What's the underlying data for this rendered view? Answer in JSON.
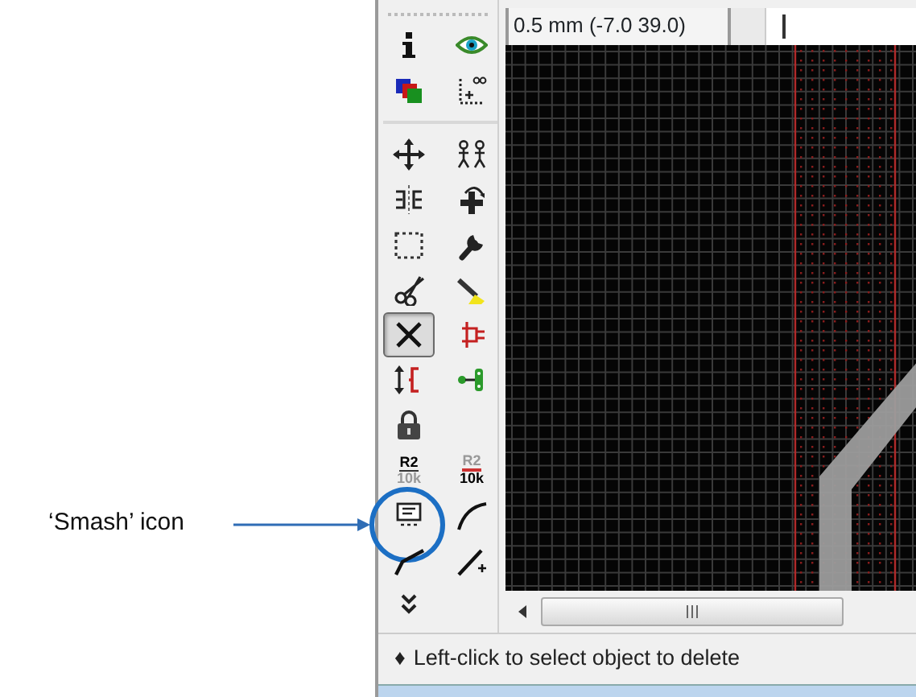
{
  "annotation": {
    "label": "‘Smash’ icon"
  },
  "toolbar": [
    {
      "kind": "info",
      "selected": false
    },
    {
      "kind": "eye",
      "selected": false
    },
    {
      "kind": "layers",
      "selected": false
    },
    {
      "kind": "mark",
      "selected": false
    },
    {
      "kind": "separator"
    },
    {
      "kind": "move",
      "selected": false
    },
    {
      "kind": "copy",
      "selected": false
    },
    {
      "kind": "mirror",
      "selected": false
    },
    {
      "kind": "rotate",
      "selected": false
    },
    {
      "kind": "group",
      "selected": false
    },
    {
      "kind": "wrench",
      "selected": false
    },
    {
      "kind": "scissors",
      "selected": false
    },
    {
      "kind": "pen",
      "selected": false
    },
    {
      "kind": "delete",
      "selected": true
    },
    {
      "kind": "ripup",
      "selected": false
    },
    {
      "kind": "swap",
      "selected": false
    },
    {
      "kind": "gateswap",
      "selected": false
    },
    {
      "kind": "lock",
      "selected": false
    },
    {
      "kind": "blank"
    },
    {
      "kind": "name",
      "selected": false,
      "lines": [
        "R2",
        "10k"
      ]
    },
    {
      "kind": "value",
      "selected": false,
      "lines": [
        "R2",
        "10k"
      ]
    },
    {
      "kind": "smash",
      "selected": false
    },
    {
      "kind": "arc",
      "selected": false
    },
    {
      "kind": "split",
      "selected": false
    },
    {
      "kind": "route",
      "selected": false
    },
    {
      "kind": "more",
      "selected": false
    }
  ],
  "coordinates": {
    "value": "0.5 mm (-7.0 39.0)"
  },
  "status_bar": {
    "bullet": "♦",
    "message": "Left-click to select object to delete"
  }
}
